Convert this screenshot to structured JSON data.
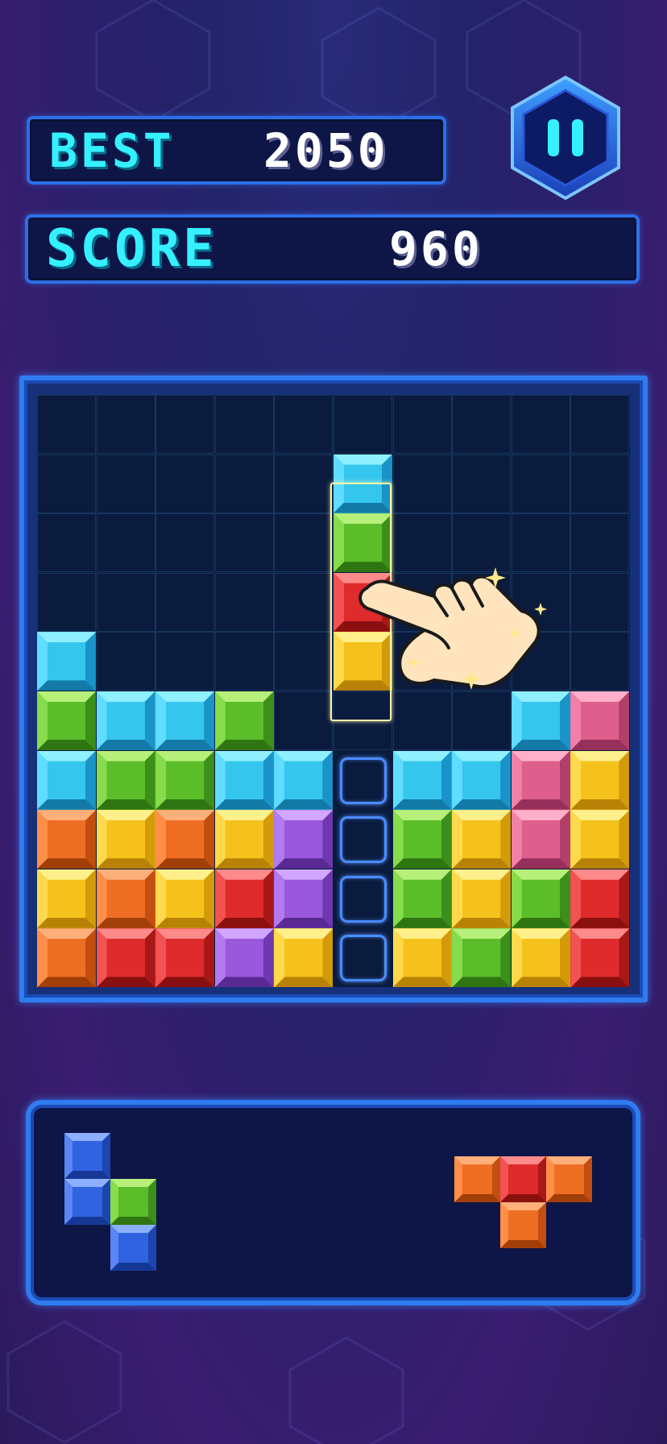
{
  "hud": {
    "best_label": "BEST",
    "best_value": "2050",
    "score_label": "SCORE",
    "score_value": "960"
  },
  "pause_button": {
    "icon": "pause-icon"
  },
  "colors": {
    "cyan": {
      "face": "#35c6ee",
      "top": "#8ff0ff",
      "left": "#5fdcff",
      "right": "#1a93c8",
      "bottom": "#137aa8"
    },
    "green": {
      "face": "#5cbd2a",
      "top": "#b6f07a",
      "left": "#86dc4c",
      "right": "#3c8f1a",
      "bottom": "#2f7612"
    },
    "red": {
      "face": "#df2b2b",
      "top": "#ff8a8a",
      "left": "#f25252",
      "right": "#a81818",
      "bottom": "#8a1010"
    },
    "yellow": {
      "face": "#f5c21c",
      "top": "#fff08c",
      "left": "#ffd94c",
      "right": "#d39a0a",
      "bottom": "#b78205"
    },
    "orange": {
      "face": "#ee6e24",
      "top": "#ffb07a",
      "left": "#ff8e48",
      "right": "#c24e10",
      "bottom": "#a23e08"
    },
    "purple": {
      "face": "#9a58dc",
      "top": "#d0a6ff",
      "left": "#b27cf0",
      "right": "#7038b0",
      "bottom": "#5a2a94"
    },
    "pink": {
      "face": "#de5f8c",
      "top": "#ffafca",
      "left": "#f080a8",
      "right": "#b23e6a",
      "bottom": "#96305a"
    },
    "blue": {
      "face": "#2f63e0",
      "top": "#8cb0ff",
      "left": "#5a86f4",
      "right": "#1d45b0",
      "bottom": "#153896"
    }
  },
  "board": {
    "cols": 10,
    "rows": 10,
    "grid": [
      [
        null,
        null,
        null,
        null,
        null,
        null,
        null,
        null,
        null,
        null
      ],
      [
        null,
        null,
        null,
        null,
        null,
        "cyan",
        null,
        null,
        null,
        null
      ],
      [
        null,
        null,
        null,
        null,
        null,
        "green",
        null,
        null,
        null,
        null
      ],
      [
        null,
        null,
        null,
        null,
        null,
        "red",
        null,
        null,
        null,
        null
      ],
      [
        "cyan",
        null,
        null,
        null,
        null,
        "yellow",
        null,
        null,
        null,
        null
      ],
      [
        "green",
        "cyan",
        "cyan",
        "green",
        null,
        null,
        null,
        null,
        "cyan",
        "pink"
      ],
      [
        "cyan",
        "green",
        "green",
        "cyan",
        "cyan",
        "slot",
        "cyan",
        "cyan",
        "pink",
        "yellow"
      ],
      [
        "orange",
        "yellow",
        "orange",
        "yellow",
        "purple",
        "slot",
        "green",
        "yellow",
        "pink",
        "yellow"
      ],
      [
        "yellow",
        "orange",
        "yellow",
        "red",
        "purple",
        "slot",
        "green",
        "yellow",
        "green",
        "red"
      ],
      [
        "orange",
        "red",
        "red",
        "purple",
        "yellow",
        "slot",
        "yellow",
        "green",
        "yellow",
        "red"
      ]
    ]
  },
  "tray": {
    "pieces": [
      {
        "name": "s-piece",
        "cells": [
          {
            "c": 0,
            "r": 0,
            "color": "blue"
          },
          {
            "c": 0,
            "r": 1,
            "color": "blue"
          },
          {
            "c": 1,
            "r": 1,
            "color": "green"
          },
          {
            "c": 1,
            "r": 2,
            "color": "blue"
          }
        ]
      },
      {
        "name": "t-piece",
        "cells": [
          {
            "c": 0,
            "r": 0,
            "color": "orange"
          },
          {
            "c": 1,
            "r": 0,
            "color": "red"
          },
          {
            "c": 2,
            "r": 0,
            "color": "orange"
          },
          {
            "c": 1,
            "r": 1,
            "color": "orange"
          }
        ]
      }
    ]
  },
  "hint": {
    "icon": "pointing-hand-icon"
  }
}
